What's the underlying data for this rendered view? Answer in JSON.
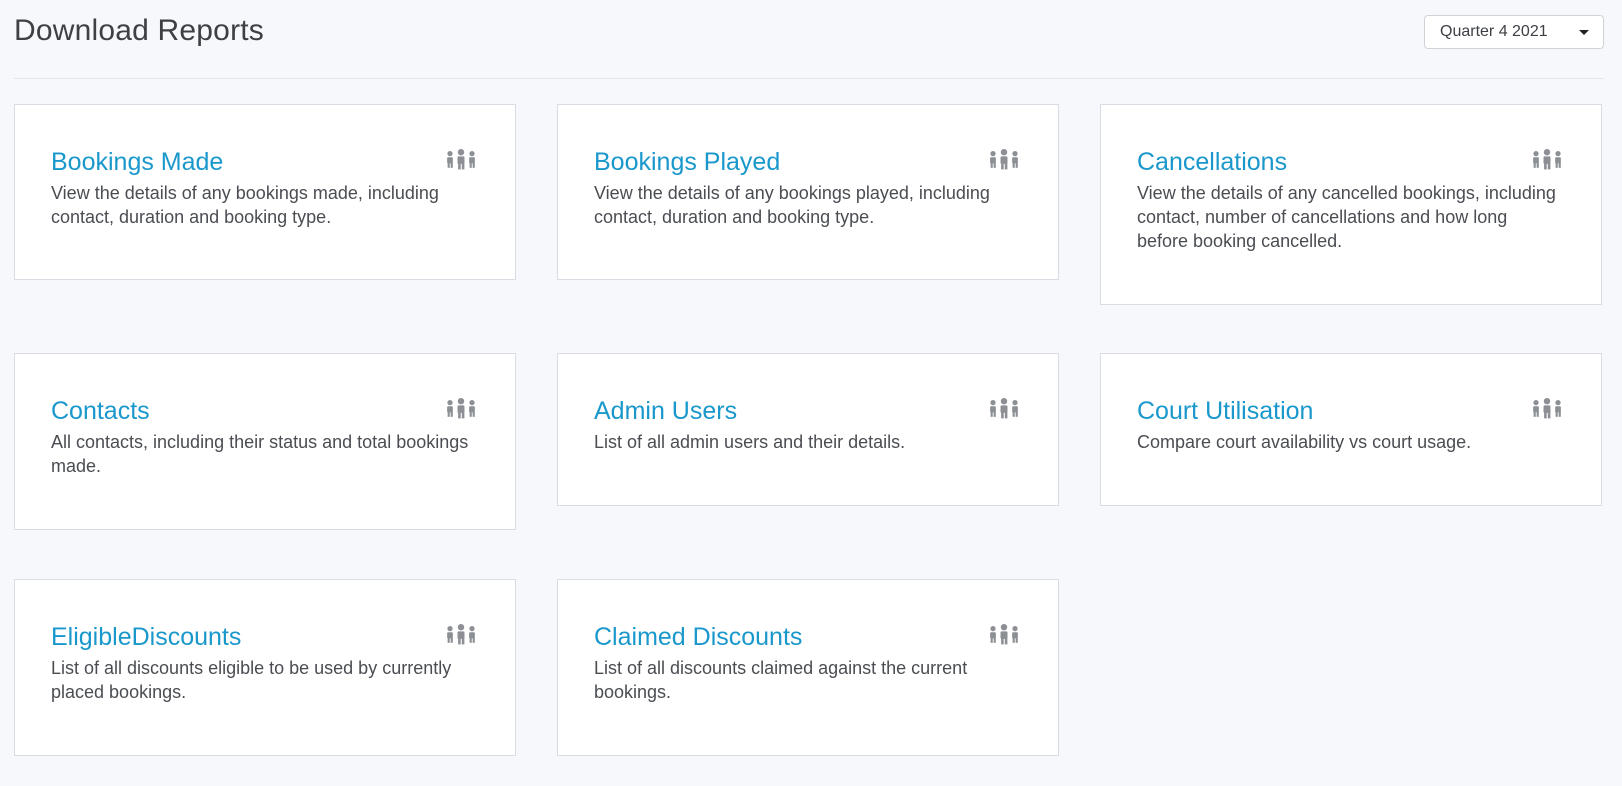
{
  "page": {
    "title": "Download Reports"
  },
  "period_select": {
    "selected": "Quarter 4 2021"
  },
  "icon_color": "#8c8f94",
  "title_color": "#1a98cc",
  "reports": [
    {
      "title": "Bookings Made",
      "description": "View the details of any bookings made, including contact, duration and booking type.",
      "icon": "people-group-icon"
    },
    {
      "title": "Bookings Played",
      "description": "View the details of any bookings played, including contact, duration and booking type.",
      "icon": "people-group-icon"
    },
    {
      "title": "Cancellations",
      "description": "View the details of any cancelled bookings, including contact, number of cancellations and how long before booking cancelled.",
      "icon": "people-group-icon"
    },
    {
      "title": "Contacts",
      "description": "All contacts, including their status and total bookings made.",
      "icon": "people-group-icon"
    },
    {
      "title": "Admin Users",
      "description": "List of all admin users and their details.",
      "icon": "people-group-icon"
    },
    {
      "title": "Court Utilisation",
      "description": "Compare court availability vs court usage.",
      "icon": "people-group-icon"
    },
    {
      "title": "EligibleDiscounts",
      "description": "List of all discounts eligible to be used by currently placed bookings.",
      "icon": "people-group-icon"
    },
    {
      "title": "Claimed Discounts",
      "description": "List of all discounts claimed against the current bookings.",
      "icon": "people-group-icon"
    }
  ]
}
